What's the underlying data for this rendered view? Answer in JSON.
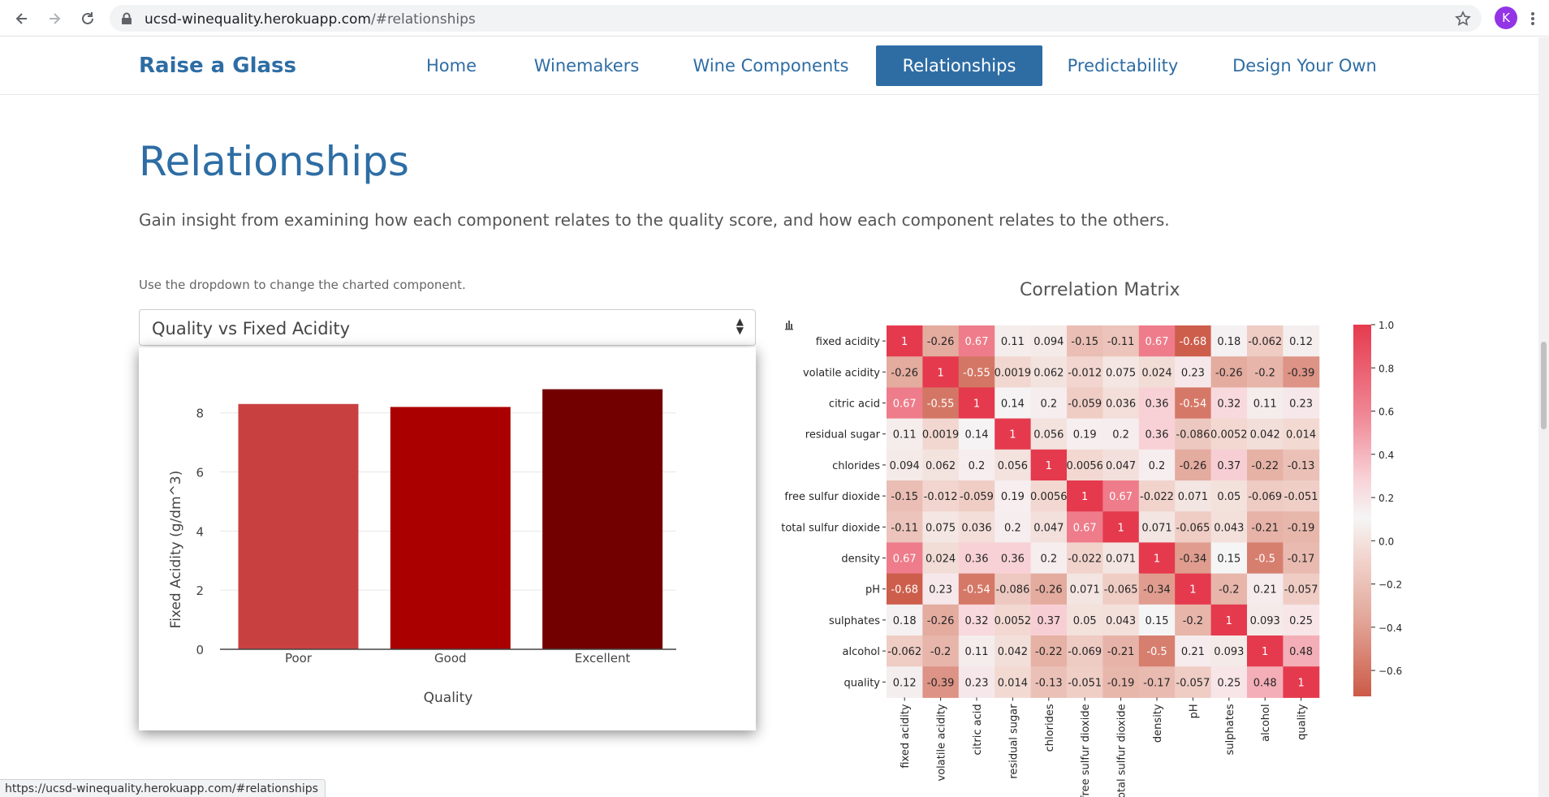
{
  "browser": {
    "url_host": "ucsd-winequality.herokuapp.com",
    "url_path": "/#relationships",
    "avatar_initial": "K",
    "status_url": "https://ucsd-winequality.herokuapp.com/#relationships"
  },
  "site": {
    "brand": "Raise a Glass",
    "nav": [
      {
        "label": "Home",
        "active": false
      },
      {
        "label": "Winemakers",
        "active": false
      },
      {
        "label": "Wine Components",
        "active": false
      },
      {
        "label": "Relationships",
        "active": true
      },
      {
        "label": "Predictability",
        "active": false
      },
      {
        "label": "Design Your Own",
        "active": false
      }
    ]
  },
  "page": {
    "title": "Relationships",
    "lead": "Gain insight from examining how each component relates to the quality score, and how each component relates to the others.",
    "hint": "Use the dropdown to change the charted component.",
    "select_value": "Quality vs Fixed Acidity",
    "corr_title": "Correlation Matrix"
  },
  "colors": {
    "brand": "#2e6da4",
    "bar_poor": "#c94040",
    "bar_good": "#aa0000",
    "bar_excellent": "#720000"
  },
  "chart_data": [
    {
      "type": "bar",
      "categories": [
        "Poor",
        "Good",
        "Excellent"
      ],
      "values": [
        8.3,
        8.2,
        8.8
      ],
      "xlabel": "Quality",
      "ylabel": "Fixed Acidity (g/dm^3)",
      "ylim": [
        0,
        9.2
      ],
      "yticks": [
        0,
        2,
        4,
        6,
        8
      ],
      "grid": true
    },
    {
      "type": "heatmap",
      "title": "Correlation Matrix",
      "labels": [
        "fixed acidity",
        "volatile acidity",
        "citric acid",
        "residual sugar",
        "chlorides",
        "free sulfur dioxide",
        "total sulfur dioxide",
        "density",
        "pH",
        "sulphates",
        "alcohol",
        "quality"
      ],
      "matrix": [
        [
          "1",
          "-0.26",
          "0.67",
          "0.11",
          "0.094",
          "-0.15",
          "-0.11",
          "0.67",
          "-0.68",
          "0.18",
          "-0.062",
          "0.12"
        ],
        [
          "-0.26",
          "1",
          "-0.55",
          "0.0019",
          "0.062",
          "-0.012",
          "0.075",
          "0.024",
          "0.23",
          "-0.26",
          "-0.2",
          "-0.39"
        ],
        [
          "0.67",
          "-0.55",
          "1",
          "0.14",
          "0.2",
          "-0.059",
          "0.036",
          "0.36",
          "-0.54",
          "0.32",
          "0.11",
          "0.23"
        ],
        [
          "0.11",
          "0.0019",
          "0.14",
          "1",
          "0.056",
          "0.19",
          "0.2",
          "0.36",
          "-0.086",
          "0.0052",
          "0.042",
          "0.014"
        ],
        [
          "0.094",
          "0.062",
          "0.2",
          "0.056",
          "1",
          "0.0056",
          "0.047",
          "0.2",
          "-0.26",
          "0.37",
          "-0.22",
          "-0.13"
        ],
        [
          "-0.15",
          "-0.012",
          "-0.059",
          "0.19",
          "0.0056",
          "1",
          "0.67",
          "-0.022",
          "0.071",
          "0.05",
          "-0.069",
          "-0.051"
        ],
        [
          "-0.11",
          "0.075",
          "0.036",
          "0.2",
          "0.047",
          "0.67",
          "1",
          "0.071",
          "-0.065",
          "0.043",
          "-0.21",
          "-0.19"
        ],
        [
          "0.67",
          "0.024",
          "0.36",
          "0.36",
          "0.2",
          "-0.022",
          "0.071",
          "1",
          "-0.34",
          "0.15",
          "-0.5",
          "-0.17"
        ],
        [
          "-0.68",
          "0.23",
          "-0.54",
          "-0.086",
          "-0.26",
          "0.071",
          "-0.065",
          "-0.34",
          "1",
          "-0.2",
          "0.21",
          "-0.057"
        ],
        [
          "0.18",
          "-0.26",
          "0.32",
          "0.0052",
          "0.37",
          "0.05",
          "0.043",
          "0.15",
          "-0.2",
          "1",
          "0.093",
          "0.25"
        ],
        [
          "-0.062",
          "-0.2",
          "0.11",
          "0.042",
          "-0.22",
          "-0.069",
          "-0.21",
          "-0.5",
          "0.21",
          "0.093",
          "1",
          "0.48"
        ],
        [
          "0.12",
          "-0.39",
          "0.23",
          "0.014",
          "-0.13",
          "-0.051",
          "-0.19",
          "-0.17",
          "-0.057",
          "0.25",
          "0.48",
          "1"
        ]
      ],
      "colorbar_ticks": [
        "1.0",
        "0.8",
        "0.6",
        "0.4",
        "0.2",
        "0.0",
        "−0.2",
        "−0.4",
        "−0.6"
      ],
      "vmin": -0.7,
      "vmax": 1.0
    }
  ]
}
